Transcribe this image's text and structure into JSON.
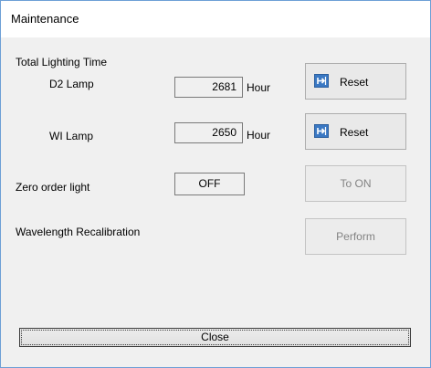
{
  "window": {
    "title": "Maintenance"
  },
  "lighting": {
    "section_label": "Total Lighting Time",
    "d2": {
      "label": "D2 Lamp",
      "value": "2681",
      "unit": "Hour",
      "reset_label": "Reset"
    },
    "wi": {
      "label": "WI Lamp",
      "value": "2650",
      "unit": "Hour",
      "reset_label": "Reset"
    }
  },
  "zero_order": {
    "label": "Zero order light",
    "status": "OFF",
    "button_label": "To ON"
  },
  "recalibration": {
    "label": "Wavelength Recalibration",
    "button_label": "Perform"
  },
  "footer": {
    "close_label": "Close"
  },
  "icons": {
    "reset": "reset-arrow-icon"
  },
  "colors": {
    "window_border": "#6d9fd6",
    "dialog_bg": "#f0f0f0",
    "icon_blue": "#3a78c3"
  }
}
